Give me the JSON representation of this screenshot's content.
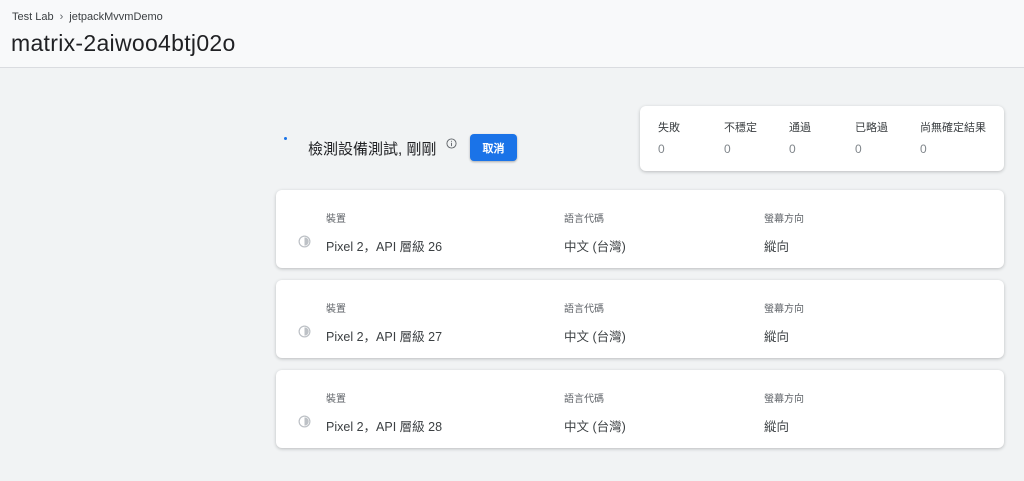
{
  "breadcrumb": {
    "root": "Test Lab",
    "project": "jetpackMvvmDemo"
  },
  "page_title": "matrix-2aiwoo4btj02o",
  "status": {
    "text": "檢測設備測試, 剛剛",
    "cancel_label": "取消"
  },
  "summary": [
    {
      "label": "失敗",
      "value": "0"
    },
    {
      "label": "不穩定",
      "value": "0"
    },
    {
      "label": "通過",
      "value": "0"
    },
    {
      "label": "已略過",
      "value": "0"
    },
    {
      "label": "尚無確定結果",
      "value": "0"
    }
  ],
  "columns": {
    "device": "裝置",
    "locale": "語言代碼",
    "orientation": "螢幕方向"
  },
  "devices": [
    {
      "device": "Pixel 2，API 層級 26",
      "locale": "中文 (台灣)",
      "orientation": "縱向",
      "icon": "pending-icon"
    },
    {
      "device": "Pixel 2，API 層級 27",
      "locale": "中文 (台灣)",
      "orientation": "縱向",
      "icon": "pending-icon"
    },
    {
      "device": "Pixel 2，API 層級 28",
      "locale": "中文 (台灣)",
      "orientation": "縱向",
      "icon": "pending-icon"
    }
  ],
  "colors": {
    "accent": "#1a73e8",
    "background": "#f1f3f4",
    "card": "#ffffff"
  }
}
